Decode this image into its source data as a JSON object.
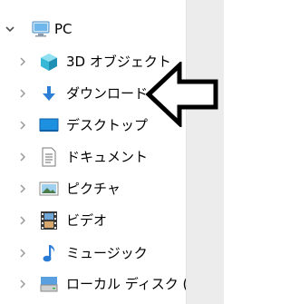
{
  "tree": {
    "root": {
      "label": "PC",
      "icon": "pc-monitor-icon",
      "expanded": true
    },
    "items": [
      {
        "label": "3D オブジェクト",
        "icon": "3d-objects-cube-icon"
      },
      {
        "label": "ダウンロード",
        "icon": "download-arrow-icon"
      },
      {
        "label": "デスクトップ",
        "icon": "desktop-icon"
      },
      {
        "label": "ドキュメント",
        "icon": "document-icon"
      },
      {
        "label": "ピクチャ",
        "icon": "pictures-icon"
      },
      {
        "label": "ビデオ",
        "icon": "video-film-icon"
      },
      {
        "label": "ミュージック",
        "icon": "music-note-icon"
      },
      {
        "label": "ローカル ディスク (C",
        "icon": "local-disk-icon"
      }
    ]
  },
  "annotation": {
    "icon": "left-arrow-callout-icon",
    "points_to": "ダウンロード"
  },
  "colors": {
    "background": "#ffffff",
    "chevron": "#9a9a9a",
    "root_chevron": "#505050",
    "scrollbar": "#ececec",
    "download_arrow": "#2d7fd6",
    "cube": "#37b8d6",
    "desktop": "#1e90e0",
    "music": "#2a7bd6"
  }
}
